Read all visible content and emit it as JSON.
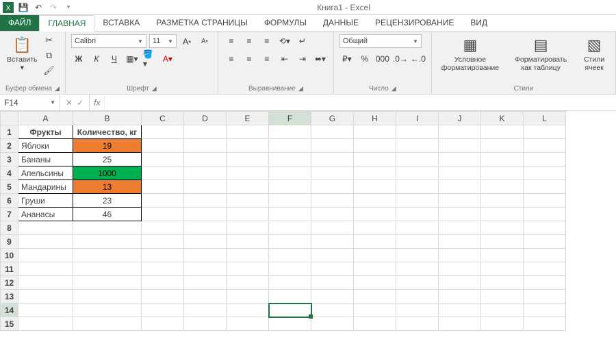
{
  "app": {
    "title": "Книга1 - Excel"
  },
  "qat": {
    "save": "💾",
    "undo": "↶",
    "redo": "↷"
  },
  "tabs": {
    "file": "ФАЙЛ",
    "items": [
      "ГЛАВНАЯ",
      "ВСТАВКА",
      "РАЗМЕТКА СТРАНИЦЫ",
      "ФОРМУЛЫ",
      "ДАННЫЕ",
      "РЕЦЕНЗИРОВАНИЕ",
      "ВИД"
    ],
    "active_index": 0
  },
  "ribbon": {
    "clipboard": {
      "paste": "Вставить",
      "label": "Буфер обмена"
    },
    "font": {
      "name": "Calibri",
      "size": "11",
      "bold": "Ж",
      "italic": "К",
      "underline": "Ч",
      "grow": "A",
      "shrink": "A",
      "label": "Шрифт"
    },
    "alignment": {
      "label": "Выравнивание"
    },
    "number": {
      "format": "Общий",
      "percent": "%",
      "comma": "000",
      "label": "Число"
    },
    "styles": {
      "cond": "Условное форматирование",
      "table": "Форматировать как таблицу",
      "cell": "Стили ячеек",
      "label": "Стили"
    }
  },
  "formula_bar": {
    "name_box": "F14",
    "formula": ""
  },
  "grid": {
    "columns": [
      "A",
      "B",
      "C",
      "D",
      "E",
      "F",
      "G",
      "H",
      "I",
      "J",
      "K",
      "L"
    ],
    "rows": 15,
    "selected": {
      "row": 14,
      "col": "F"
    },
    "data": {
      "header": {
        "A": "Фрукты",
        "B": "Количество, кг"
      },
      "items": [
        {
          "A": "Яблоки",
          "B": "19",
          "hl": "orange"
        },
        {
          "A": "Бананы",
          "B": "25",
          "hl": null
        },
        {
          "A": "Апельсины",
          "B": "1000",
          "hl": "green"
        },
        {
          "A": "Мандарины",
          "B": "13",
          "hl": "orange"
        },
        {
          "A": "Груши",
          "B": "23",
          "hl": null
        },
        {
          "A": "Ананасы",
          "B": "46",
          "hl": null
        }
      ]
    }
  },
  "colors": {
    "accent": "#217346",
    "orange": "#ed7d31",
    "green": "#00b050"
  }
}
